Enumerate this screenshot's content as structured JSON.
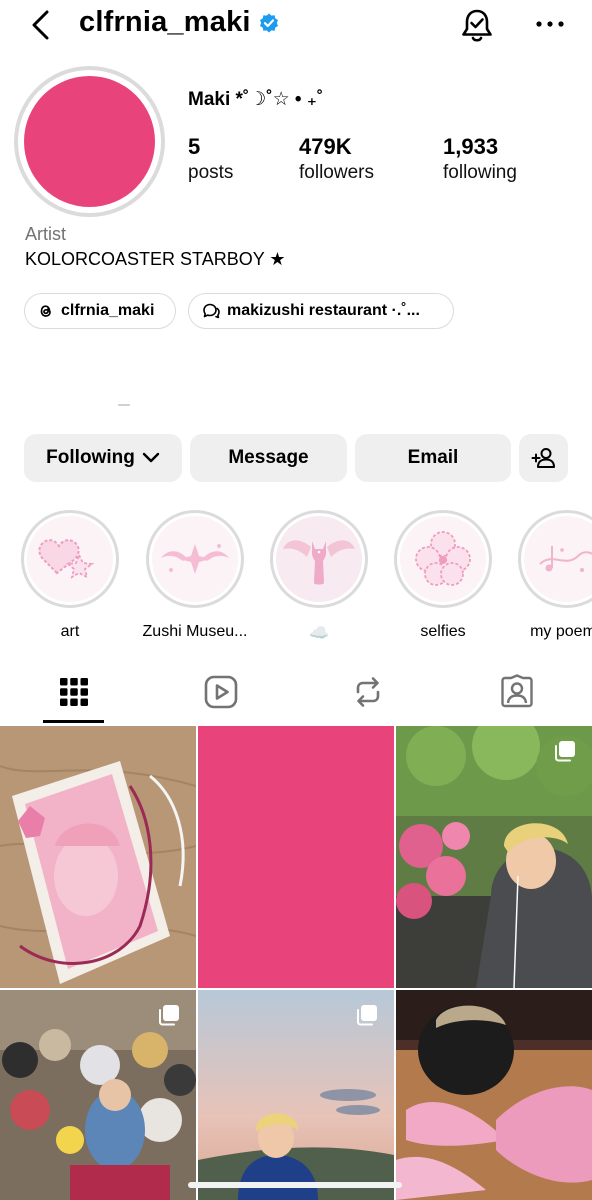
{
  "header": {
    "username": "clfrnia_maki",
    "verified": true,
    "back_icon": "chevron-left-icon",
    "bell_icon": "bell-check-icon",
    "more_icon": "more-horizontal-icon"
  },
  "profile": {
    "display_name": "Maki *˚☽˚☆ • ₊˚",
    "avatar_color": "#e8437a",
    "stats": {
      "posts": {
        "value": "5",
        "label": "posts"
      },
      "followers": {
        "value": "479K",
        "label": "followers"
      },
      "following": {
        "value": "1,933",
        "label": "following"
      }
    },
    "category": "Artist",
    "bio": "KOLORCOASTER STARBOY ★",
    "links": [
      {
        "icon": "threads-icon",
        "label": "clfrnia_maki"
      },
      {
        "icon": "messenger-channel-icon",
        "label": "makizushi restaurant ·.˚..."
      }
    ]
  },
  "actions": {
    "following": "Following",
    "message": "Message",
    "email": "Email",
    "add_user_icon": "add-person-icon"
  },
  "highlights": [
    {
      "label": "art",
      "icon": "pixel-heart-icon"
    },
    {
      "label": "Zushi Museu...",
      "icon": "sparkle-wing-icon"
    },
    {
      "label": "☁️",
      "icon": "winged-cat-icon"
    },
    {
      "label": "selfies",
      "icon": "clover-icon"
    },
    {
      "label": "my poems",
      "icon": "music-note-icon"
    }
  ],
  "tabs": [
    {
      "name": "posts",
      "icon": "grid-icon",
      "active": true
    },
    {
      "name": "reels",
      "icon": "reels-icon",
      "active": false
    },
    {
      "name": "reposts",
      "icon": "repost-icon",
      "active": false
    },
    {
      "name": "tagged",
      "icon": "tagged-person-icon",
      "active": false
    }
  ],
  "grid_posts": [
    {
      "id": "post-1",
      "kind": "photo",
      "multi": false,
      "description": "pink drawing on wooden desk"
    },
    {
      "id": "post-2",
      "kind": "solid",
      "multi": false,
      "color": "#e8437a"
    },
    {
      "id": "post-3",
      "kind": "photo",
      "multi": true,
      "description": "person by pink flowers"
    },
    {
      "id": "post-4",
      "kind": "photo",
      "multi": true,
      "description": "plush toys pile"
    },
    {
      "id": "post-5",
      "kind": "photo",
      "multi": true,
      "description": "sunset selfie"
    },
    {
      "id": "post-6",
      "kind": "photo",
      "multi": false,
      "description": "pink wings in gym"
    }
  ],
  "colors": {
    "accent_pink": "#e8437a",
    "verified_blue": "#1d9bf0",
    "button_bg": "#efefef",
    "muted_text": "#737373"
  }
}
